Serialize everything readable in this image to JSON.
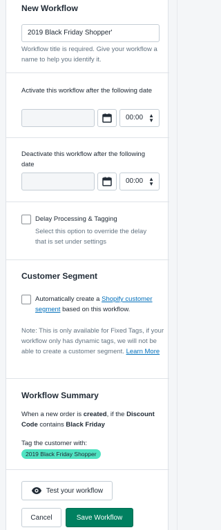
{
  "general": {
    "title": "New Workflow",
    "title_value": "2019 Black Friday Shopper'",
    "title_help": "Workflow title is required. Give your workflow a name to help you identify it."
  },
  "activate": {
    "label": "Activate this workflow after the following date",
    "time": "00:00"
  },
  "deactivate": {
    "label": "Deactivate this workflow after the following date",
    "time": "00:00"
  },
  "delay": {
    "label": "Delay Processing & Tagging",
    "help": "Select this option to override the delay that is set under settings"
  },
  "segment": {
    "title": "Customer Segment",
    "label_pre": "Automatically create a ",
    "label_link": "Shopify customer segment",
    "label_post": " based on this workflow.",
    "note": "Note: This is only available for Fixed Tags, if your workflow only has dynamic tags, we will not be able to create a customer segment. ",
    "learn_more": "Learn More"
  },
  "summary": {
    "title": "Workflow Summary",
    "when_pre": "When a new order is ",
    "when_event": "created",
    "when_mid": ", if the ",
    "when_field": "Discount Code",
    "when_op": " contains ",
    "when_value": "Black Friday",
    "tag_label": "Tag the customer with:",
    "tag": "2019 Black Friday Shopper"
  },
  "actions": {
    "test": "Test your workflow",
    "cancel": "Cancel",
    "save": "Save Workflow"
  },
  "colors": {
    "tag_bg": "#50e3c2",
    "primary": "#008060",
    "link": "#006fbb"
  }
}
